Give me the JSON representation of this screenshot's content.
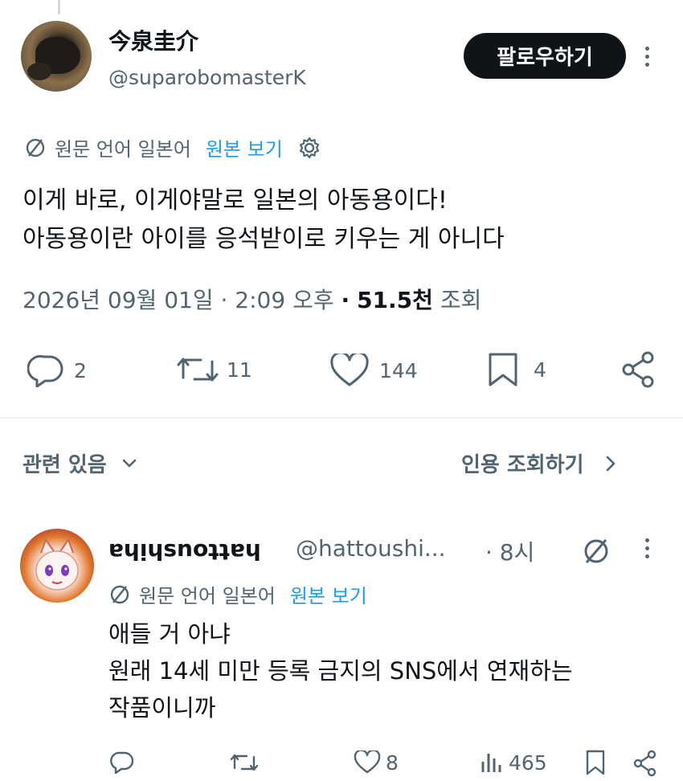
{
  "tweet": {
    "display_name": "今泉圭介",
    "handle": "@suparobomasterK",
    "follow_label": "팔로우하기",
    "translation_note": "원문 언어 일본어",
    "view_original": "원본 보기",
    "text_line1": "이게 바로, 이게야말로 일본의 아동용이다!",
    "text_line2": "아동용이란 아이를 응석받이로 키우는 게 아니다",
    "timestamp": "2026년 09월 01일 · 2:09 오후",
    "separator": "·",
    "views_count": "51.5천",
    "views_label": "조회",
    "replies": "2",
    "retweets": "11",
    "likes": "144",
    "bookmarks": "4"
  },
  "related": {
    "left_label": "관련 있음",
    "right_label": "인용 조회하기"
  },
  "reply": {
    "display_name": "ɐɥᴉɥsnoʇʇɐɥ",
    "handle": "@hattoushi...",
    "time": "· 8시",
    "translation_note": "원문 언어 일본어",
    "view_original": "원본 보기",
    "text_line1": "애들 거 아냐",
    "text_line2": "원래 14세 미만 등록 금지의 SNS에서 연재하는",
    "text_line3": "작품이니까",
    "likes": "8",
    "views": "465"
  },
  "colors": {
    "text": "#0f1419",
    "secondary": "#536471",
    "link": "#1d9bf0",
    "button_bg": "#0f1419"
  }
}
